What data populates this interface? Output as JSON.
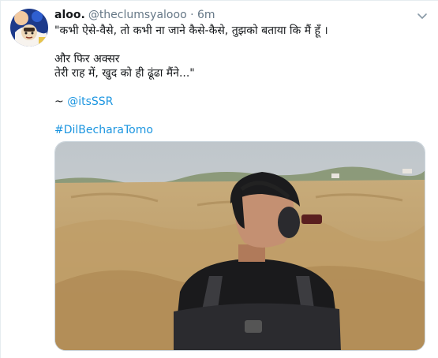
{
  "tweet": {
    "display_name": "aloo.",
    "handle": "@theclumsyalooo",
    "separator": "·",
    "time": "6m",
    "lines": [
      "\"कभी ऐसे-वैसे, तो कभी ना जाने कैसे-कैसे, तुझको बताया कि मैं हूँ ।",
      "और फिर अक्सर",
      "तेरी राह में, खुद को ही ढूंढा मैंने...\""
    ],
    "mention_prefix": "~ ",
    "mention": "@itsSSR",
    "hashtag": "#DilBecharaTomo"
  },
  "icons": {
    "caret": "chevron-down-icon"
  },
  "colors": {
    "link": "#1b95e0",
    "secondary_text": "#657786",
    "border": "#e6ecf0",
    "sky": "#c9cfd3",
    "terrain": "#c9aa75"
  }
}
